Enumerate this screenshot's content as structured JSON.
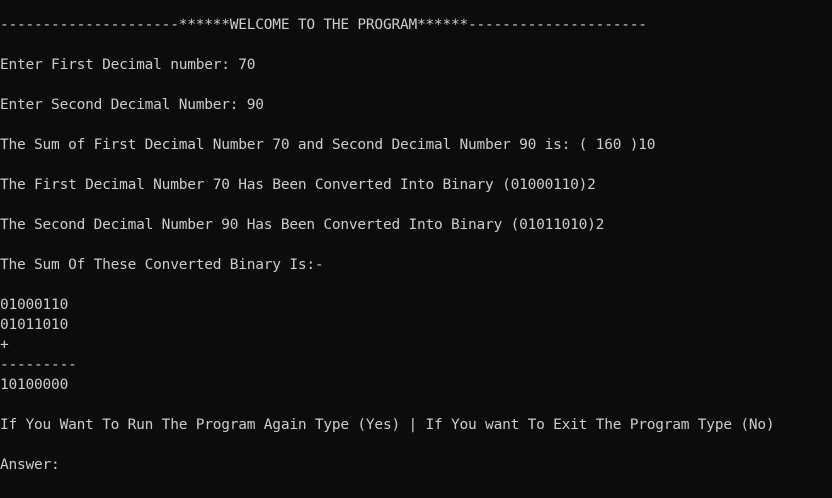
{
  "console": {
    "banner": "---------------------******WELCOME TO THE PROGRAM******---------------------",
    "first_prompt": "Enter First Decimal number: 70",
    "second_prompt": "Enter Second Decimal Number: 90",
    "sum_decimal": "The Sum of First Decimal Number 70 and Second Decimal Number 90 is: ( 160 )10",
    "first_binary": "The First Decimal Number 70 Has Been Converted Into Binary (01000110)2",
    "second_binary": "The Second Decimal Number 90 Has Been Converted Into Binary (01011010)2",
    "sum_heading": "The Sum Of These Converted Binary Is:-",
    "operand_1": "01000110",
    "operand_2": "01011010",
    "plus_sign": "+",
    "separator": "---------",
    "binary_result": "10100000",
    "rerun_prompt": "If You Want To Run The Program Again Type (Yes) | If You want To Exit The Program Type (No)",
    "answer_prompt": "Answer:"
  },
  "colors": {
    "background": "#0c0c0c",
    "foreground": "#cccccc"
  }
}
